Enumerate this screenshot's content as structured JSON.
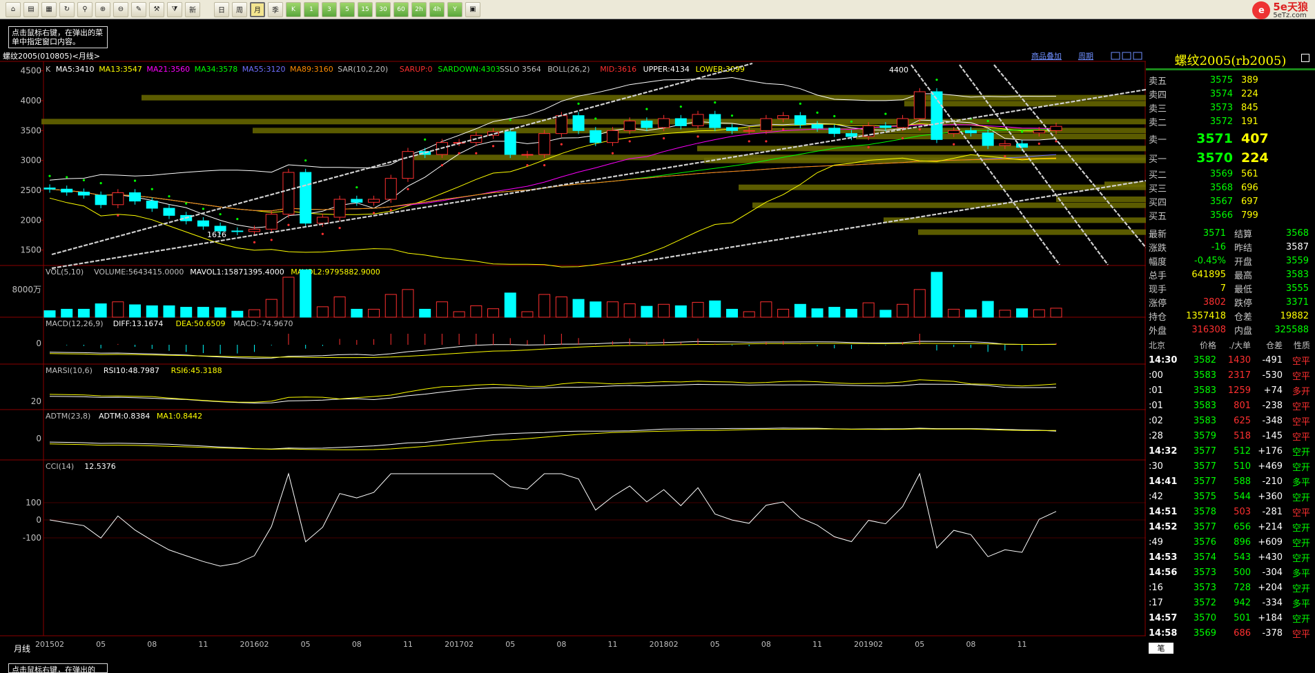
{
  "toolbar": {
    "buttons": [
      {
        "name": "home-icon",
        "glyph": "⌂"
      },
      {
        "name": "folder-icon",
        "glyph": "▤"
      },
      {
        "name": "report-icon",
        "glyph": "▦"
      },
      {
        "name": "refresh-icon",
        "glyph": "↻"
      },
      {
        "name": "search-icon",
        "glyph": "⚲"
      },
      {
        "name": "zoom-in-icon",
        "glyph": "⊕"
      },
      {
        "name": "zoom-out-icon",
        "glyph": "⊖"
      },
      {
        "name": "draw-icon",
        "glyph": "✎"
      },
      {
        "name": "tools-icon",
        "glyph": "⚒"
      },
      {
        "name": "filter-icon",
        "glyph": "⧩"
      },
      {
        "name": "new-icon",
        "glyph": "新"
      }
    ],
    "periods": [
      "日",
      "周",
      "月",
      "季",
      "K",
      "1",
      "3",
      "5",
      "15",
      "30",
      "60",
      "2h",
      "4h",
      "Y"
    ],
    "active_period": "月",
    "calc_icon": "▣"
  },
  "logo": {
    "mark": "e",
    "brand": "5e天狼",
    "site": "5eTz.com"
  },
  "tooltips": {
    "top": "点击鼠标右键，在弹出的菜单中指定窗口内容。",
    "bottom": "点击鼠标右键，在弹出的"
  },
  "chart": {
    "header_title": "螺纹2005(010805)<月线>",
    "links": [
      "商品叠加",
      "周期"
    ],
    "main_indicators": [
      {
        "t": "K",
        "c": "#c0c0c0"
      },
      {
        "t": "MA5:3410",
        "c": "#ffffff"
      },
      {
        "t": "MA13:3547",
        "c": "#ffff00"
      },
      {
        "t": "MA21:3560",
        "c": "#ff00ff"
      },
      {
        "t": "MA34:3578",
        "c": "#00ff00"
      },
      {
        "t": "MA55:3120",
        "c": "#6f6fff"
      },
      {
        "t": "MA89:3160",
        "c": "#ff8c00"
      },
      {
        "t": "SAR(10,2,20)",
        "c": "#c0c0c0"
      },
      {
        "t": "SARUP:0",
        "c": "#ff3030"
      },
      {
        "t": "SARDOWN:4303",
        "c": "#00ff00"
      },
      {
        "t": "SSLO 3564",
        "c": "#c0c0c0"
      },
      {
        "t": "BOLL(26,2)",
        "c": "#c0c0c0"
      },
      {
        "t": "MID:3616",
        "c": "#ff3030"
      },
      {
        "t": "UPPER:4134",
        "c": "#ffffff"
      },
      {
        "t": "LOWER:3099",
        "c": "#ffff00"
      }
    ],
    "y_labels": [
      "4500",
      "4000",
      "3500",
      "3000",
      "2500",
      "2000",
      "1500"
    ],
    "y_values": [
      4500,
      4000,
      3500,
      3000,
      2500,
      2000,
      1500
    ],
    "annotations": {
      "high": "4400",
      "low": "1616"
    },
    "vol": {
      "items": [
        {
          "t": "VOL(5,10)",
          "c": "#c0c0c0"
        },
        {
          "t": "VOLUME:5643415.0000",
          "c": "#c0c0c0"
        },
        {
          "t": "MAVOL1:15871395.4000",
          "c": "#ffffff"
        },
        {
          "t": "MAVOL2:9795882.9000",
          "c": "#ffff00"
        }
      ],
      "y": "8000万"
    },
    "macd": {
      "items": [
        {
          "t": "MACD(12,26,9)",
          "c": "#c0c0c0"
        },
        {
          "t": "DIFF:13.1674",
          "c": "#ffffff"
        },
        {
          "t": "DEA:50.6509",
          "c": "#ffff00"
        },
        {
          "t": "MACD:-74.9670",
          "c": "#c0c0c0"
        }
      ],
      "y": "0"
    },
    "marsi": {
      "items": [
        {
          "t": "MARSI(10,6)",
          "c": "#c0c0c0"
        },
        {
          "t": "RSI10:48.7987",
          "c": "#ffffff"
        },
        {
          "t": "RSI6:45.3188",
          "c": "#ffff00"
        }
      ],
      "y": "20"
    },
    "adtm": {
      "items": [
        {
          "t": "ADTM(23,8)",
          "c": "#c0c0c0"
        },
        {
          "t": "ADTM:0.8384",
          "c": "#ffffff"
        },
        {
          "t": "MA1:0.8442",
          "c": "#ffff00"
        }
      ],
      "y": "0"
    },
    "cci": {
      "items": [
        {
          "t": "CCI(14)",
          "c": "#c0c0c0"
        },
        {
          "t": "12.5376",
          "c": "#ffffff"
        }
      ],
      "y": [
        "100",
        "0",
        "-100"
      ]
    },
    "x_labels": [
      "201502",
      "05",
      "08",
      "11",
      "201602",
      "05",
      "08",
      "11",
      "201702",
      "05",
      "08",
      "11",
      "201802",
      "05",
      "08",
      "11",
      "201902",
      "05",
      "08",
      "11"
    ],
    "period_label": "月线"
  },
  "quote": {
    "title": "螺纹2005(rb2005)",
    "asks": [
      {
        "l": "卖五",
        "p": "3575",
        "v": "389"
      },
      {
        "l": "卖四",
        "p": "3574",
        "v": "224"
      },
      {
        "l": "卖三",
        "p": "3573",
        "v": "845"
      },
      {
        "l": "卖二",
        "p": "3572",
        "v": "191"
      },
      {
        "l": "卖一",
        "p": "3571",
        "v": "407"
      }
    ],
    "bids": [
      {
        "l": "买一",
        "p": "3570",
        "v": "224"
      },
      {
        "l": "买二",
        "p": "3569",
        "v": "561"
      },
      {
        "l": "买三",
        "p": "3568",
        "v": "696"
      },
      {
        "l": "买四",
        "p": "3567",
        "v": "697"
      },
      {
        "l": "买五",
        "p": "3566",
        "v": "799"
      }
    ],
    "stats": [
      {
        "l1": "最新",
        "v1": "3571",
        "c1": "#00ff00",
        "l2": "结算",
        "v2": "3568",
        "c2": "#00ff00"
      },
      {
        "l1": "涨跌",
        "v1": "-16",
        "c1": "#00ff00",
        "l2": "昨结",
        "v2": "3587",
        "c2": "#ffffff"
      },
      {
        "l1": "幅度",
        "v1": "-0.45%",
        "c1": "#00ff00",
        "l2": "开盘",
        "v2": "3559",
        "c2": "#00ff00"
      },
      {
        "l1": "总手",
        "v1": "641895",
        "c1": "#ffff00",
        "l2": "最高",
        "v2": "3583",
        "c2": "#00ff00"
      },
      {
        "l1": "现手",
        "v1": "7",
        "c1": "#ffff00",
        "l2": "最低",
        "v2": "3555",
        "c2": "#00ff00"
      },
      {
        "l1": "涨停",
        "v1": "3802",
        "c1": "#ff3030",
        "l2": "跌停",
        "v2": "3371",
        "c2": "#00ff00"
      },
      {
        "l1": "持仓",
        "v1": "1357418",
        "c1": "#ffff00",
        "l2": "仓差",
        "v2": "19882",
        "c2": "#ffff00"
      },
      {
        "l1": "外盘",
        "v1": "316308",
        "c1": "#ff3030",
        "l2": "内盘",
        "v2": "325588",
        "c2": "#00ff00"
      }
    ],
    "tick_header": [
      "北京",
      "价格",
      "./大单",
      "仓差",
      "性质"
    ],
    "ticks": [
      {
        "t": "14:30",
        "p": "3582",
        "v": "1430",
        "d": "-491",
        "n": "空平",
        "vc": "#ff3030",
        "nc": "#ff3030"
      },
      {
        "t": ":00",
        "p": "3583",
        "v": "2317",
        "d": "-530",
        "n": "空平",
        "vc": "#ff3030",
        "nc": "#ff3030"
      },
      {
        "t": ":01",
        "p": "3583",
        "v": "1259",
        "d": "+74",
        "n": "多开",
        "vc": "#ff3030",
        "nc": "#ff3030"
      },
      {
        "t": ":01",
        "p": "3583",
        "v": "801",
        "d": "-238",
        "n": "空平",
        "vc": "#ff3030",
        "nc": "#ff3030"
      },
      {
        "t": ":02",
        "p": "3583",
        "v": "625",
        "d": "-348",
        "n": "空平",
        "vc": "#ff3030",
        "nc": "#ff3030"
      },
      {
        "t": ":28",
        "p": "3579",
        "v": "518",
        "d": "-145",
        "n": "空平",
        "vc": "#ff3030",
        "nc": "#ff3030"
      },
      {
        "t": "14:32",
        "p": "3577",
        "v": "512",
        "d": "+176",
        "n": "空开",
        "vc": "#00ff00",
        "nc": "#00ff00"
      },
      {
        "t": ":30",
        "p": "3577",
        "v": "510",
        "d": "+469",
        "n": "空开",
        "vc": "#00ff00",
        "nc": "#00ff00"
      },
      {
        "t": "14:41",
        "p": "3577",
        "v": "588",
        "d": "-210",
        "n": "多平",
        "vc": "#00ff00",
        "nc": "#00ff00"
      },
      {
        "t": ":42",
        "p": "3575",
        "v": "544",
        "d": "+360",
        "n": "空开",
        "vc": "#00ff00",
        "nc": "#00ff00"
      },
      {
        "t": "14:51",
        "p": "3578",
        "v": "503",
        "d": "-281",
        "n": "空平",
        "vc": "#ff3030",
        "nc": "#ff3030"
      },
      {
        "t": "14:52",
        "p": "3577",
        "v": "656",
        "d": "+214",
        "n": "空开",
        "vc": "#00ff00",
        "nc": "#00ff00"
      },
      {
        "t": ":49",
        "p": "3576",
        "v": "896",
        "d": "+609",
        "n": "空开",
        "vc": "#00ff00",
        "nc": "#00ff00"
      },
      {
        "t": "14:53",
        "p": "3574",
        "v": "543",
        "d": "+430",
        "n": "空开",
        "vc": "#00ff00",
        "nc": "#00ff00"
      },
      {
        "t": "14:56",
        "p": "3573",
        "v": "500",
        "d": "-304",
        "n": "多平",
        "vc": "#00ff00",
        "nc": "#00ff00"
      },
      {
        "t": ":16",
        "p": "3573",
        "v": "728",
        "d": "+204",
        "n": "空开",
        "vc": "#00ff00",
        "nc": "#00ff00"
      },
      {
        "t": ":17",
        "p": "3572",
        "v": "942",
        "d": "-334",
        "n": "多平",
        "vc": "#00ff00",
        "nc": "#00ff00"
      },
      {
        "t": "14:57",
        "p": "3570",
        "v": "501",
        "d": "+184",
        "n": "空开",
        "vc": "#00ff00",
        "nc": "#00ff00"
      },
      {
        "t": "14:58",
        "p": "3569",
        "v": "686",
        "d": "-378",
        "n": "空平",
        "vc": "#ff3030",
        "nc": "#ff3030"
      }
    ],
    "footer_tab": "笔"
  },
  "colors": {
    "up": "#ff3030",
    "down": "#00ffff",
    "grid": "#8b0000",
    "bands": "#6b6b00"
  },
  "chart_data": {
    "type": "candlestick",
    "title": "螺纹2005(010805)<月线>",
    "x": [
      "201502",
      "201503",
      "201504",
      "201505",
      "201506",
      "201507",
      "201508",
      "201509",
      "201510",
      "201511",
      "201512",
      "201601",
      "201602",
      "201603",
      "201604",
      "201605",
      "201606",
      "201607",
      "201608",
      "201609",
      "201610",
      "201611",
      "201612",
      "201701",
      "201702",
      "201703",
      "201704",
      "201705",
      "201706",
      "201707",
      "201708",
      "201709",
      "201710",
      "201711",
      "201712",
      "201801",
      "201802",
      "201803",
      "201804",
      "201805",
      "201806",
      "201807",
      "201808",
      "201809",
      "201810",
      "201811",
      "201812",
      "201901",
      "201902",
      "201903",
      "201904",
      "201905",
      "201906",
      "201907",
      "201908",
      "201909",
      "201910",
      "201911",
      "201912",
      "202001"
    ],
    "open": [
      2540,
      2520,
      2470,
      2420,
      2260,
      2460,
      2320,
      2200,
      2080,
      1990,
      1900,
      1820,
      1810,
      1850,
      2100,
      2800,
      1950,
      2050,
      2350,
      2300,
      2350,
      2700,
      3150,
      3100,
      3300,
      3300,
      3420,
      3480,
      3100,
      3100,
      3450,
      3750,
      3500,
      3300,
      3500,
      3660,
      3550,
      3700,
      3580,
      3770,
      3550,
      3500,
      3500,
      3700,
      3750,
      3600,
      3540,
      3450,
      3400,
      3580,
      3550,
      3700,
      4150,
      3450,
      3500,
      3460,
      3250,
      3280,
      3460,
      3500
    ],
    "close": [
      2520,
      2470,
      2420,
      2260,
      2460,
      2320,
      2200,
      2080,
      1990,
      1900,
      1820,
      1810,
      1850,
      2100,
      2800,
      1950,
      2050,
      2350,
      2300,
      2350,
      2700,
      3150,
      3100,
      3300,
      3300,
      3420,
      3480,
      3100,
      3100,
      3450,
      3750,
      3500,
      3300,
      3500,
      3660,
      3550,
      3700,
      3580,
      3770,
      3550,
      3500,
      3500,
      3700,
      3750,
      3600,
      3540,
      3450,
      3400,
      3580,
      3550,
      3700,
      4150,
      3350,
      3500,
      3460,
      3250,
      3280,
      3220,
      3500,
      3571
    ],
    "ylim": [
      1300,
      4600
    ],
    "x_labels": [
      "201502",
      "05",
      "08",
      "11",
      "201602",
      "05",
      "08",
      "11",
      "201702",
      "05",
      "08",
      "11",
      "201802",
      "05",
      "08",
      "11",
      "201902",
      "05",
      "08",
      "11"
    ]
  }
}
